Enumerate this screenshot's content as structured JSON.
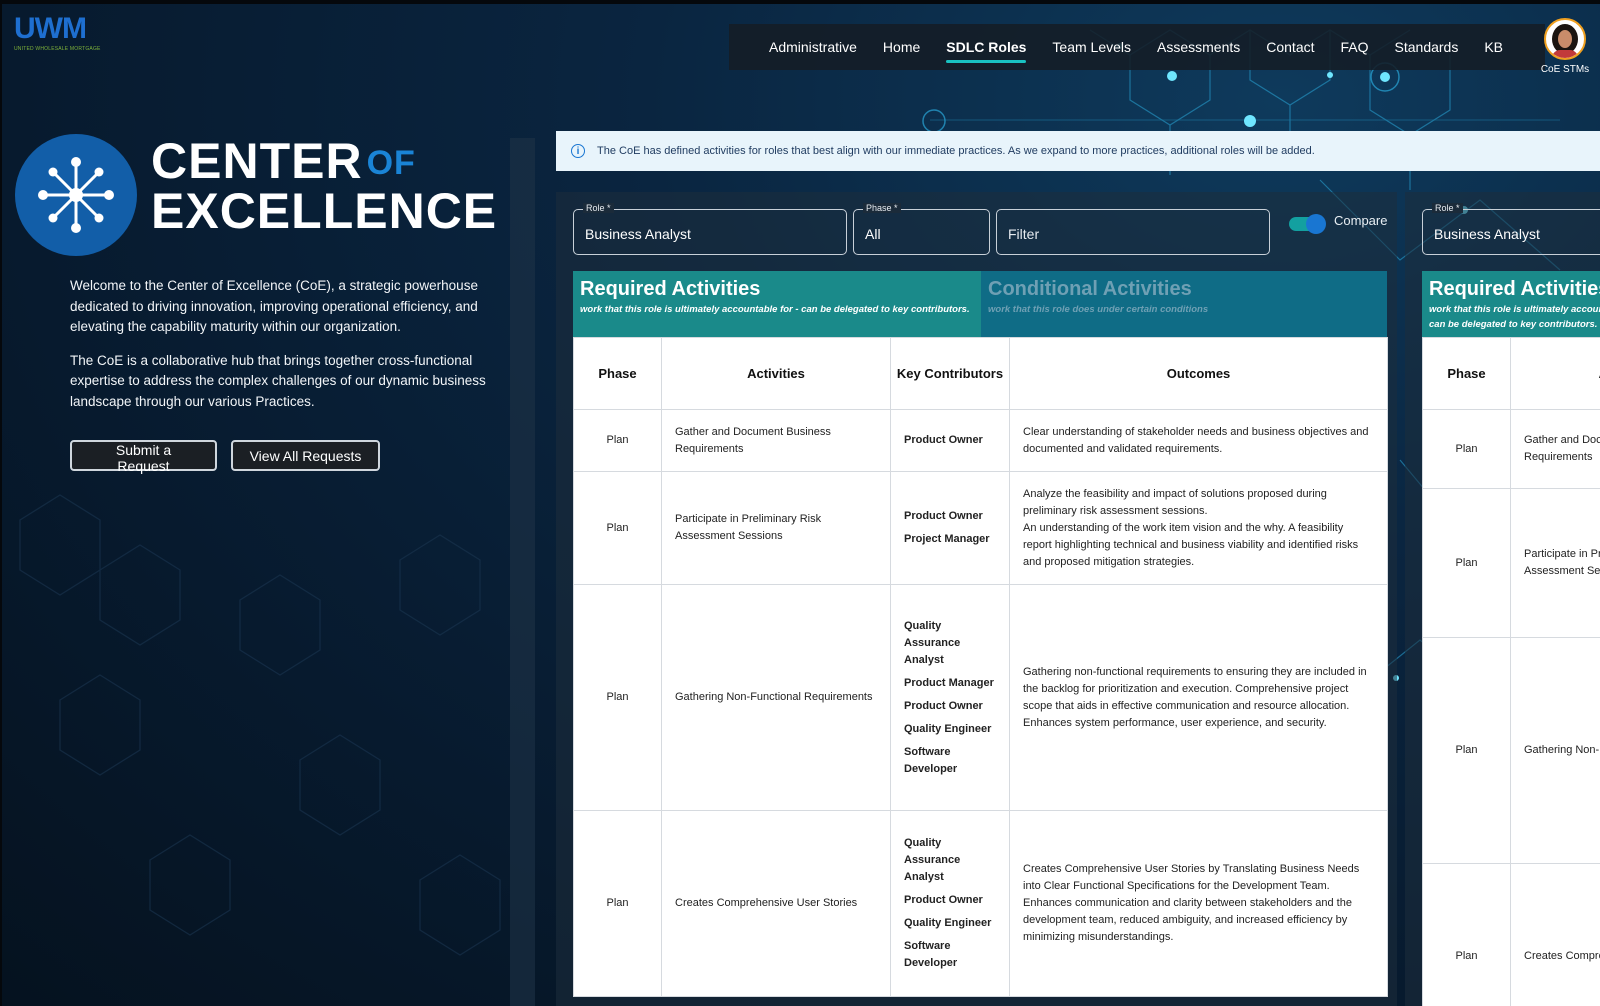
{
  "logo": {
    "brand": "UWM",
    "tagline": "UNITED WHOLESALE MORTGAGE"
  },
  "nav": {
    "items": [
      {
        "label": "Administrative",
        "active": false
      },
      {
        "label": "Home",
        "active": false
      },
      {
        "label": "SDLC Roles",
        "active": true
      },
      {
        "label": "Team Levels",
        "active": false
      },
      {
        "label": "Assessments",
        "active": false
      },
      {
        "label": "Contact",
        "active": false
      },
      {
        "label": "FAQ",
        "active": false
      },
      {
        "label": "Standards",
        "active": false
      },
      {
        "label": "KB",
        "active": false
      }
    ],
    "profile_name": "CoE STMs"
  },
  "hero": {
    "title_line1": "CENTER",
    "title_of": "OF",
    "title_line2": "EXCELLENCE",
    "paragraph1": "Welcome to the Center of Excellence (CoE), a strategic powerhouse dedicated to driving innovation, improving operational efficiency, and elevating the capability maturity within our organization.",
    "paragraph2": "The CoE is a collaborative hub that brings together cross-functional expertise to address the complex challenges of our dynamic business landscape through our various Practices.",
    "submit_label": "Submit a Request",
    "view_label": "View All Requests"
  },
  "banner": {
    "text": "The CoE has defined activities for roles that best align with our immediate practices. As we expand to more practices, additional roles will be added."
  },
  "panel1": {
    "role_label": "Role *",
    "role_value": "Business Analyst",
    "phase_label": "Phase *",
    "phase_value": "All",
    "filter_placeholder": "Filter",
    "compare_label": "Compare",
    "compare_on": true,
    "tab_required_title": "Required Activities",
    "tab_required_sub": "work that this role is ultimately accountable for - can be delegated to key contributors.",
    "tab_conditional_title": "Conditional Activities",
    "tab_conditional_sub": "work that this role does under certain conditions",
    "headers": {
      "phase": "Phase",
      "activities": "Activities",
      "key_contributors": "Key Contributors",
      "outcomes": "Outcomes"
    },
    "rows": [
      {
        "phase": "Plan",
        "activity": "Gather and Document Business Requirements",
        "contributors": [
          "Product Owner"
        ],
        "outcomes": [
          "Clear understanding of stakeholder needs and business objectives and documented and validated requirements."
        ]
      },
      {
        "phase": "Plan",
        "activity": "Participate in Preliminary Risk Assessment Sessions",
        "contributors": [
          "Product Owner",
          "Project Manager"
        ],
        "outcomes": [
          "Analyze the feasibility and impact of solutions proposed during preliminary risk assessment sessions.",
          "An understanding of the work item vision and the why. A feasibility report highlighting technical and business viability and identified risks and proposed mitigation strategies."
        ]
      },
      {
        "phase": "Plan",
        "activity": "Gathering Non-Functional Requirements",
        "contributors": [
          "Quality Assurance Analyst",
          "Product Manager",
          "Product Owner",
          "Quality Engineer",
          "Software Developer"
        ],
        "outcomes": [
          "Gathering non-functional requirements to ensuring they are included in the backlog for prioritization and execution. Comprehensive project scope that aids in effective communication and resource allocation. Enhances system performance, user experience, and security."
        ]
      },
      {
        "phase": "Plan",
        "activity": "Creates Comprehensive User Stories",
        "contributors": [
          "Quality Assurance Analyst",
          "Product Owner",
          "Quality Engineer",
          "Software Developer"
        ],
        "outcomes": [
          "Creates Comprehensive User Stories by Translating Business Needs into Clear Functional Specifications for the Development Team.",
          "Enhances communication and clarity between stakeholders and the development team, reduced ambiguity, and increased efficiency by minimizing misunderstandings."
        ]
      }
    ]
  },
  "panel2": {
    "role_label": "Role *",
    "role_value": "Business Analyst",
    "tab_required_title": "Required Activities",
    "tab_required_sub": "work that this role is ultimately accountable for - can be delegated to key contributors.",
    "headers": {
      "phase": "Phase",
      "activities": "Activities"
    },
    "rows": [
      {
        "phase": "Plan",
        "activity": "Gather and Document Business Requirements"
      },
      {
        "phase": "Plan",
        "activity": "Participate in Preliminary Risk Assessment Sessions"
      },
      {
        "phase": "Plan",
        "activity": "Gathering Non-Functional Requirements"
      },
      {
        "phase": "Plan",
        "activity": "Creates Comprehensive User Stories"
      }
    ]
  },
  "colors": {
    "accent_teal": "#1a8a8a",
    "brand_blue": "#125ea8",
    "nav_underline": "#19c2c2"
  }
}
